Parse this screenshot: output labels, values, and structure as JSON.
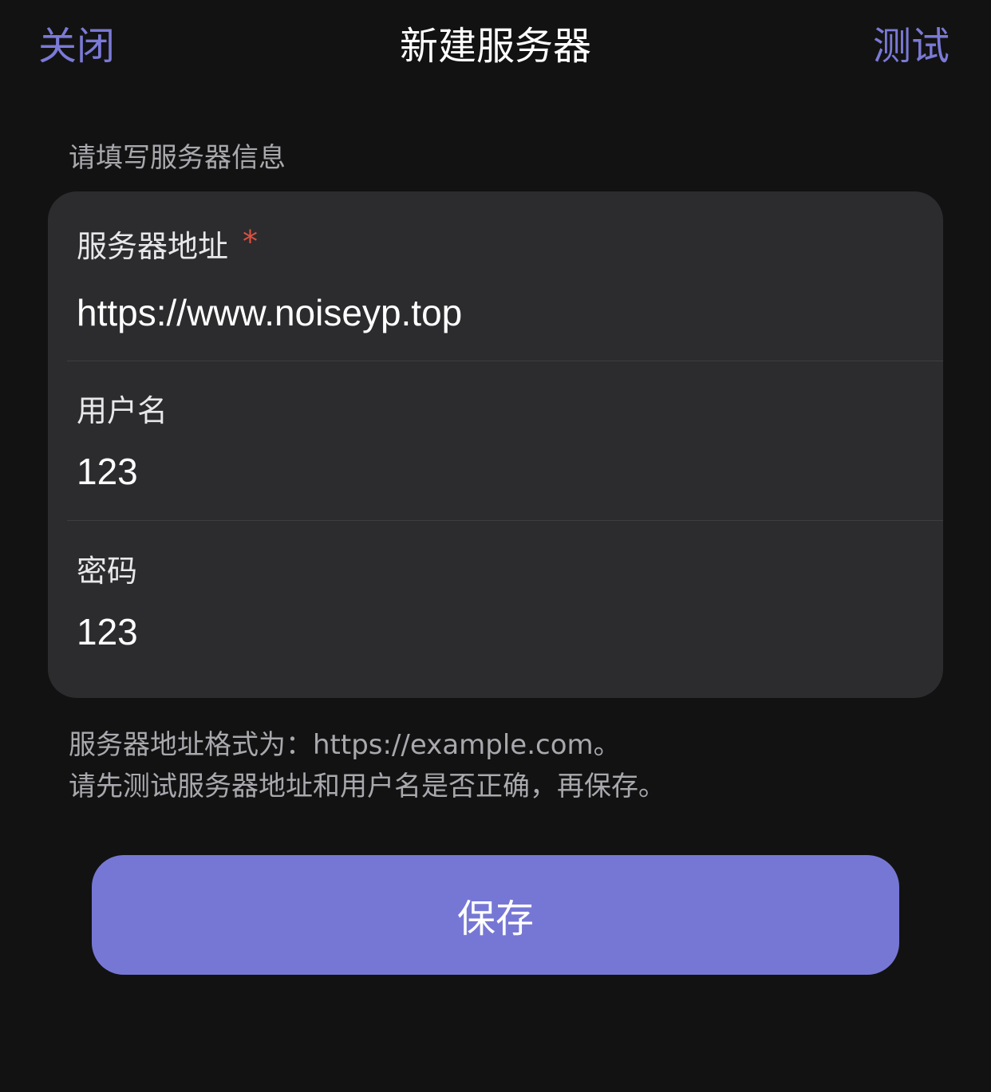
{
  "nav": {
    "close_label": "关闭",
    "title": "新建服务器",
    "test_label": "测试"
  },
  "section": {
    "header": "请填写服务器信息"
  },
  "fields": {
    "server_address": {
      "label": "服务器地址",
      "required_mark": "*",
      "value": "https://www.noiseyp.top"
    },
    "username": {
      "label": "用户名",
      "value": "123"
    },
    "password": {
      "label": "密码",
      "value": "123"
    }
  },
  "footer": {
    "line1": "服务器地址格式为：https://example.com。",
    "line2": "请先测试服务器地址和用户名是否正确，再保存。"
  },
  "save_button": {
    "label": "保存"
  },
  "colors": {
    "background": "#121213",
    "card": "#2c2c2e",
    "accent": "#7677d5",
    "required": "#e0503f"
  }
}
